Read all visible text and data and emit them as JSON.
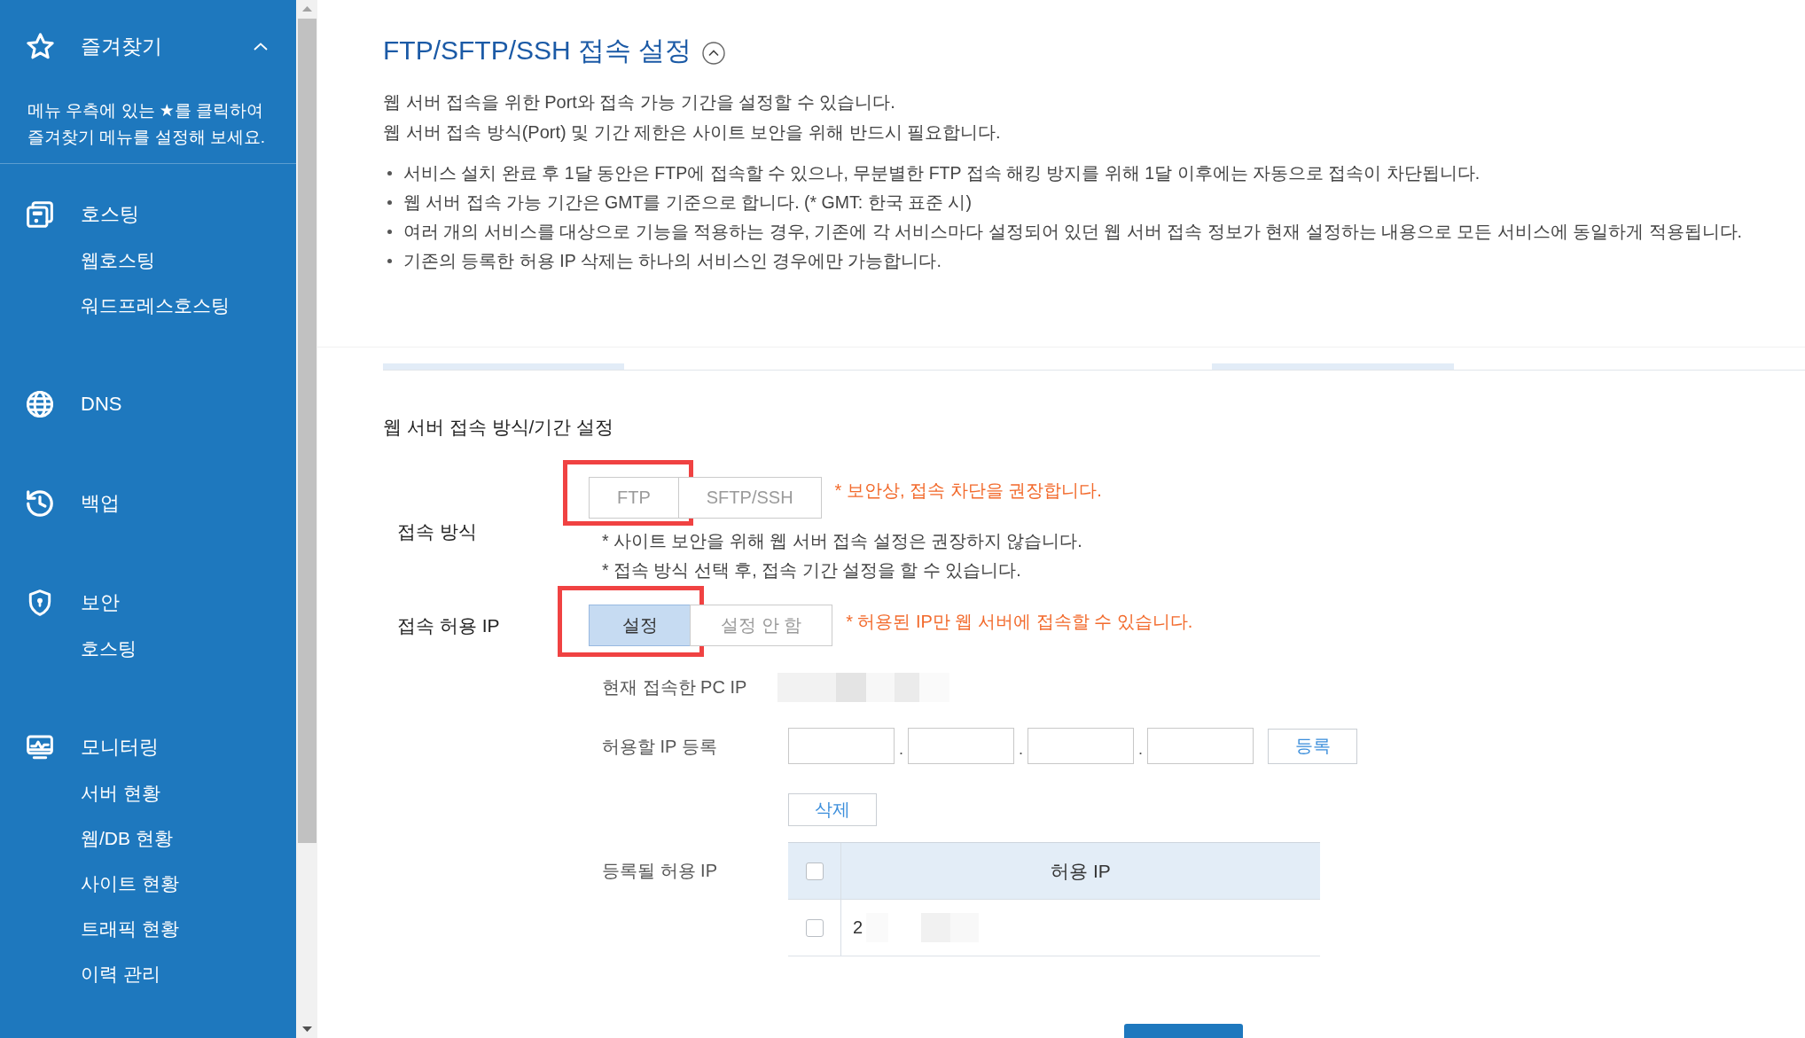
{
  "sidebar": {
    "favorites": {
      "title": "즐겨찾기",
      "expanded": true,
      "hint": "메뉴 우측에 있는 ★를 클릭하여\n즐겨찾기 메뉴를 설정해 보세요."
    },
    "groups": [
      {
        "label": "호스팅",
        "children": [
          {
            "label": "웹호스팅"
          },
          {
            "label": "워드프레스호스팅"
          }
        ]
      },
      {
        "label": "DNS"
      },
      {
        "label": "백업"
      },
      {
        "label": "보안",
        "children": [
          {
            "label": "호스팅"
          }
        ]
      },
      {
        "label": "모니터링",
        "children": [
          {
            "label": "서버 현황"
          },
          {
            "label": "웹/DB 현황"
          },
          {
            "label": "사이트 현황"
          },
          {
            "label": "트래픽 현황"
          },
          {
            "label": "이력 관리"
          }
        ]
      }
    ]
  },
  "section": {
    "title": "FTP/SFTP/SSH 접속 설정",
    "expanded": true,
    "intro": [
      "웹 서버 접속을 위한 Port와 접속 가능 기간을 설정할 수 있습니다.",
      "웹 서버 접속 방식(Port) 및 기간 제한은 사이트 보안을 위해 반드시 필요합니다."
    ],
    "notes": [
      "서비스 설치 완료 후 1달 동안은 FTP에 접속할 수 있으나, 무분별한 FTP 접속 해킹 방지를 위해 1달 이후에는 자동으로 접속이 차단됩니다.",
      "웹 서버 접속 가능 기간은 GMT를 기준으로 합니다. (* GMT: 한국 표준 시)",
      "여러 개의 서비스를 대상으로 기능을 적용하는 경우, 기존에 각 서비스마다 설정되어 있던 웹 서버 접속 정보가 현재 설정하는 내용으로 모든 서비스에 동일하게 적용됩니다.",
      "기존의 등록한 허용 IP 삭제는 하나의 서비스인 경우에만 가능합니다."
    ]
  },
  "settings": {
    "heading": "웹 서버 접속 방식/기간 설정",
    "access_method": {
      "label": "접속 방식",
      "options": [
        {
          "label": "FTP",
          "selected": false,
          "highlighted": true
        },
        {
          "label": "SFTP/SSH",
          "selected": false,
          "highlighted": false
        }
      ],
      "warning": "* 보안상, 접속 차단을 권장합니다.",
      "notes": [
        "* 사이트 보안을 위해 웹 서버 접속 설정은 권장하지 않습니다.",
        "* 접속 방식 선택 후, 접속 기간 설정을 할 수 있습니다."
      ]
    },
    "allowed_ip": {
      "label": "접속 허용 IP",
      "options": [
        {
          "label": "설정",
          "selected": true,
          "highlighted": true
        },
        {
          "label": "설정 안 함",
          "selected": false,
          "highlighted": false
        }
      ],
      "warning": "* 허용된 IP만 웹 서버에 접속할 수 있습니다.",
      "current_ip": {
        "label": "현재 접속한 PC IP"
      },
      "register": {
        "label": "허용할 IP 등록",
        "separators": [
          ".",
          ".",
          "."
        ],
        "button": "등록"
      },
      "delete_button": "삭제",
      "registered": {
        "label": "등록될 허용 IP",
        "select_all": {
          "checked": false
        },
        "columns": [
          "허용 IP"
        ],
        "rows": [
          {
            "checked": false,
            "ip": "2"
          }
        ]
      }
    }
  }
}
